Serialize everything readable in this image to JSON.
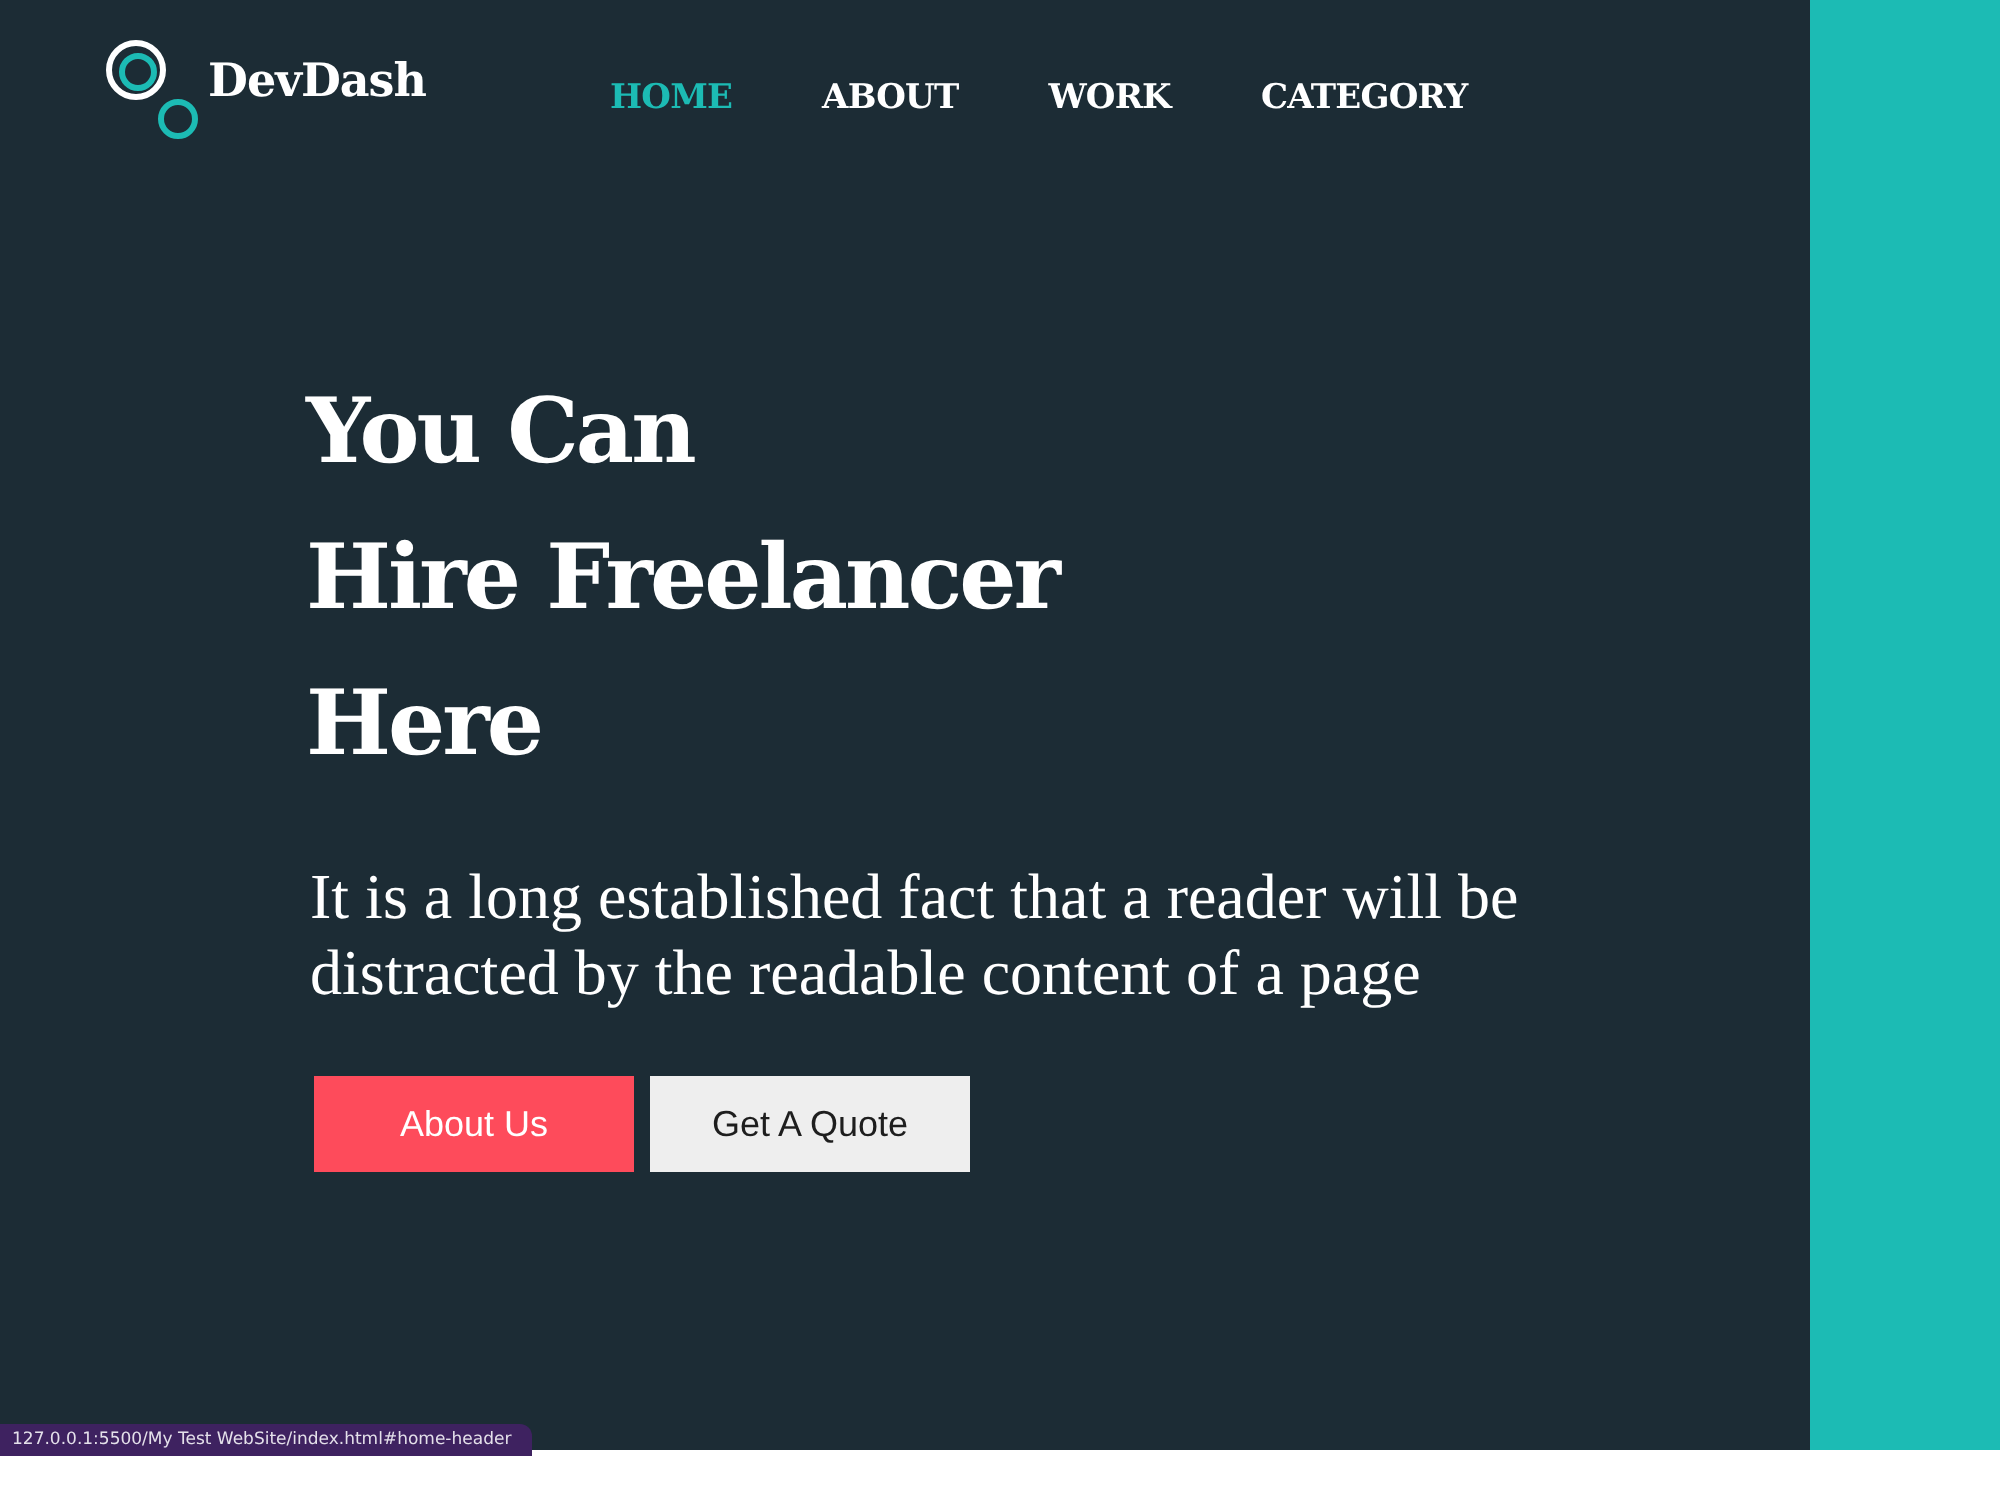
{
  "logo": {
    "text": "DevDash"
  },
  "nav": [
    {
      "label": "HOME",
      "selected": true
    },
    {
      "label": "ABOUT",
      "selected": false
    },
    {
      "label": "WORK",
      "selected": false
    },
    {
      "label": "CATEGORY",
      "selected": false
    }
  ],
  "hero": {
    "title_lines": [
      "You Can",
      "Hire Freelancer",
      "Here"
    ],
    "text": "It is a long established fact that a reader will be distracted by the readable content of a page",
    "buttons": [
      {
        "label": "About Us",
        "kind": "primary"
      },
      {
        "label": "Get A Quote",
        "kind": "secondary"
      }
    ]
  },
  "status_link": "127.0.0.1:5500/My Test WebSite/index.html#home-header"
}
